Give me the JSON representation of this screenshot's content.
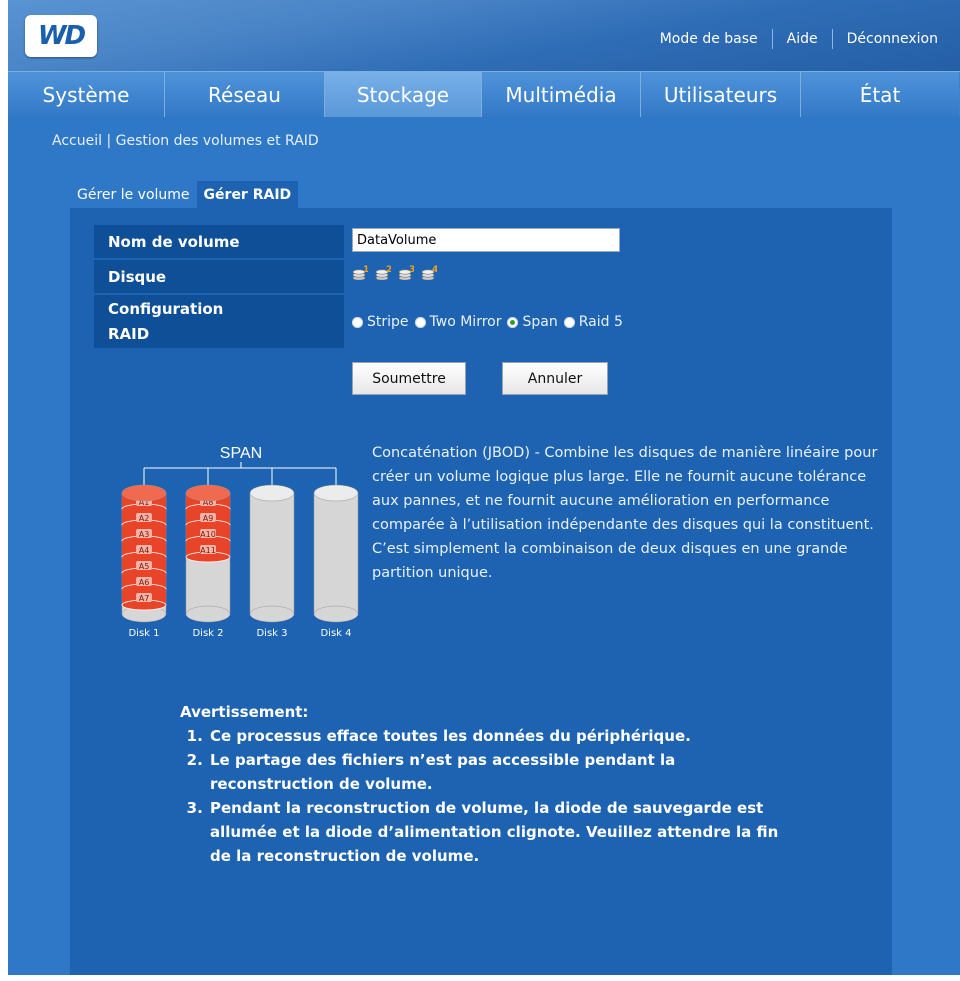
{
  "header": {
    "logo_text": "WD",
    "links": [
      "Mode de base",
      "Aide",
      "Déconnexion"
    ]
  },
  "nav": {
    "tabs": [
      {
        "label": "Système",
        "active": false
      },
      {
        "label": "Réseau",
        "active": false
      },
      {
        "label": "Stockage",
        "active": true
      },
      {
        "label": "Multimédia",
        "active": false
      },
      {
        "label": "Utilisateurs",
        "active": false
      },
      {
        "label": "État",
        "active": false
      }
    ]
  },
  "breadcrumb": "Accueil | Gestion des volumes et RAID",
  "subtabs": [
    {
      "label": "Gérer le volume",
      "active": false
    },
    {
      "label": "Gérer RAID",
      "active": true
    }
  ],
  "form": {
    "volume_label": "Nom de volume",
    "volume_value": "DataVolume",
    "disk_label": "Disque",
    "disks": [
      "1",
      "2",
      "3",
      "4"
    ],
    "raid_label_1": "Configuration",
    "raid_label_2": "RAID",
    "raid_options": [
      {
        "label": "Stripe",
        "selected": false
      },
      {
        "label": "Two Mirror",
        "selected": false
      },
      {
        "label": "Span",
        "selected": true
      },
      {
        "label": "Raid 5",
        "selected": false
      }
    ],
    "submit_label": "Soumettre",
    "cancel_label": "Annuler"
  },
  "diagram": {
    "title": "SPAN",
    "disks": [
      {
        "name": "Disk 1",
        "blocks": [
          "A1",
          "A2",
          "A3",
          "A4",
          "A5",
          "A6",
          "A7"
        ]
      },
      {
        "name": "Disk 2",
        "blocks": [
          "A8",
          "A9",
          "A10",
          "A11"
        ]
      },
      {
        "name": "Disk 3",
        "blocks": []
      },
      {
        "name": "Disk 4",
        "blocks": []
      }
    ],
    "colors": {
      "block": "#e8442a",
      "empty": "#d6d6d6"
    }
  },
  "description": "Concaténation (JBOD) - Combine les disques de manière linéaire pour créer un volume logique plus large. Elle ne fournit aucune tolérance aux pannes, et ne fournit aucune amélioration en performance comparée à l’utilisation indépendante des disques qui la constituent. C’est simplement la combinaison de deux disques en une grande partition unique.",
  "warning": {
    "title": "Avertissement:",
    "items": [
      "Ce processus efface toutes les données du périphérique.",
      "Le partage des fichiers n’est pas accessible pendant la reconstruction de volume.",
      "Pendant la reconstruction de volume, la diode de sauvegarde est allumée et la diode d’alimentation clignote. Veuillez attendre la fin de la reconstruction de volume."
    ]
  }
}
